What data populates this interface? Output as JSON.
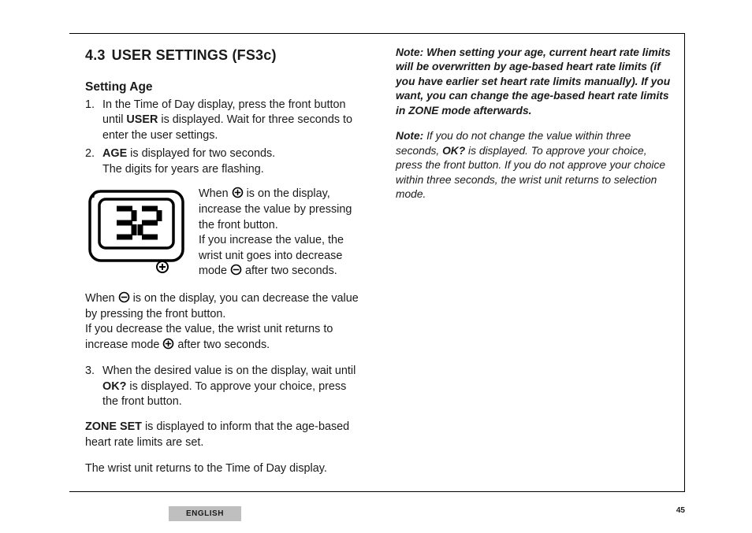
{
  "section": {
    "number": "4.3",
    "title": "USER SETTINGS (FS3c)"
  },
  "sub1": {
    "title": "Setting Age",
    "step1": {
      "t1": "In the Time of Day display, press the front button until ",
      "b1": "USER",
      "t2": " is displayed. Wait for three seconds to enter the user settings."
    },
    "step2": {
      "b1": "AGE",
      "t1": " is displayed for two seconds.",
      "t2": "The digits for years are flashing."
    }
  },
  "plus_block": {
    "t1": "When ",
    "t2": " is on the display, increase the value by pressing the front button.",
    "t3": "If you increase the value, the wrist unit goes into decrease mode ",
    "t4": " after two seconds."
  },
  "minus_block": {
    "t1": "When ",
    "t2": " is on the display, you can decrease the value by pressing the front button.",
    "t3": "If you decrease the value, the wrist unit returns to increase mode ",
    "t4": " after two seconds."
  },
  "step3": {
    "t1": "When the desired value is on the display, wait until ",
    "b1": "OK?",
    "t2": " is displayed. To approve your choice, press the front button."
  },
  "zone_set": {
    "b1": "ZONE SET",
    "t1": " is displayed to inform that the age-based heart rate limits are set."
  },
  "return_line": "The wrist unit returns to the Time of Day display.",
  "note1": {
    "lead": "Note:",
    "t": " When setting your age, current heart rate limits will be overwritten by age-based heart rate limits (if you have earlier set heart rate limits manually). If you want, you can change the age-based heart rate limits in ZONE mode afterwards."
  },
  "note2": {
    "lead": "Note:",
    "t1": " If you do not change the value within three seconds, ",
    "b1": "OK?",
    "t2": " is displayed. To approve your choice, press the front button. If you do not approve your choice within three seconds, the wrist unit returns to selection mode."
  },
  "device": {
    "value": "32"
  },
  "footer": {
    "language": "ENGLISH",
    "page": "45"
  }
}
